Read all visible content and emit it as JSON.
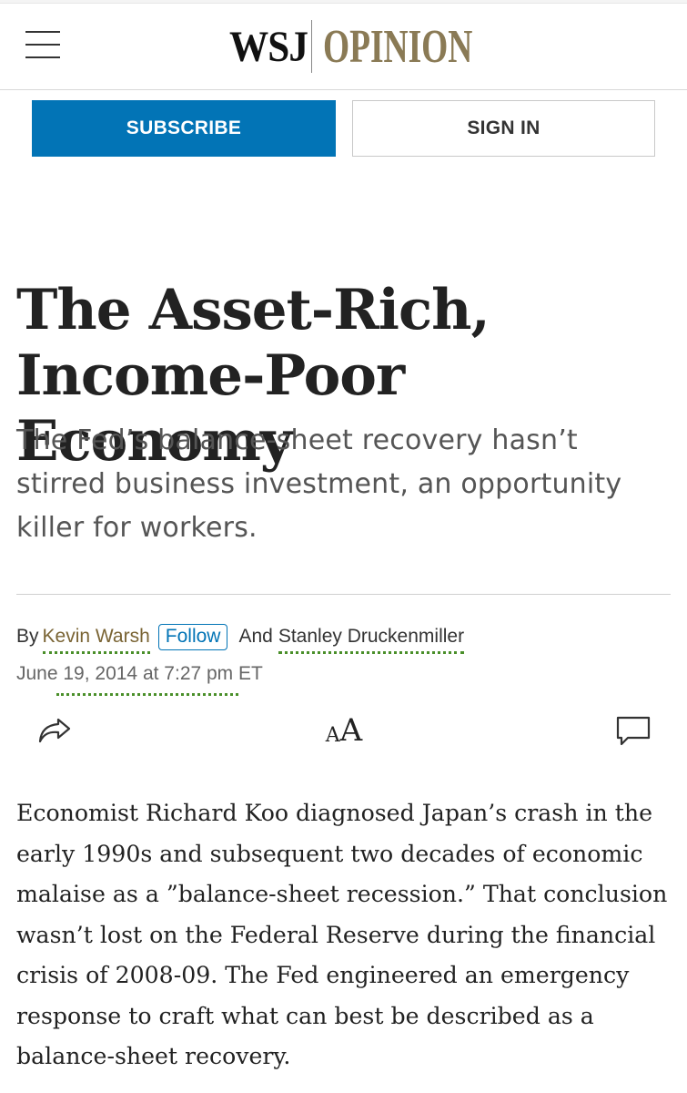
{
  "header": {
    "logo_main": "WSJ",
    "logo_section": "OPINION",
    "colors": {
      "section": "#8a7a55",
      "accent": "#0274b6"
    }
  },
  "actions": {
    "subscribe_label": "SUBSCRIBE",
    "signin_label": "SIGN IN"
  },
  "article": {
    "headline": "The Asset-Rich, Income-Poor Economy",
    "dek": "The Fed’s balance-sheet recovery hasn’t stirred business investment, an opportunity killer for workers.",
    "byline": {
      "prefix": "By",
      "author1": "Kevin Warsh",
      "follow_label": "Follow",
      "conjunction": "And",
      "author2": "Stanley Druckenmiller"
    },
    "date": "June 19, 2014 at 7:27 pm ET",
    "tools": {
      "share_icon": "share-icon",
      "text_size_small": "A",
      "text_size_large": "A",
      "comment_icon": "comment-icon"
    },
    "body": "Economist Richard Koo diagnosed Japan’s crash in the early 1990s and subsequent two decades of economic malaise as a ”balance-sheet recession.” That conclusion wasn’t lost on the Federal Reserve during the financial crisis of 2008-09. The Fed engineered an emergency response to craft what can best be described as a balance-sheet recovery."
  }
}
